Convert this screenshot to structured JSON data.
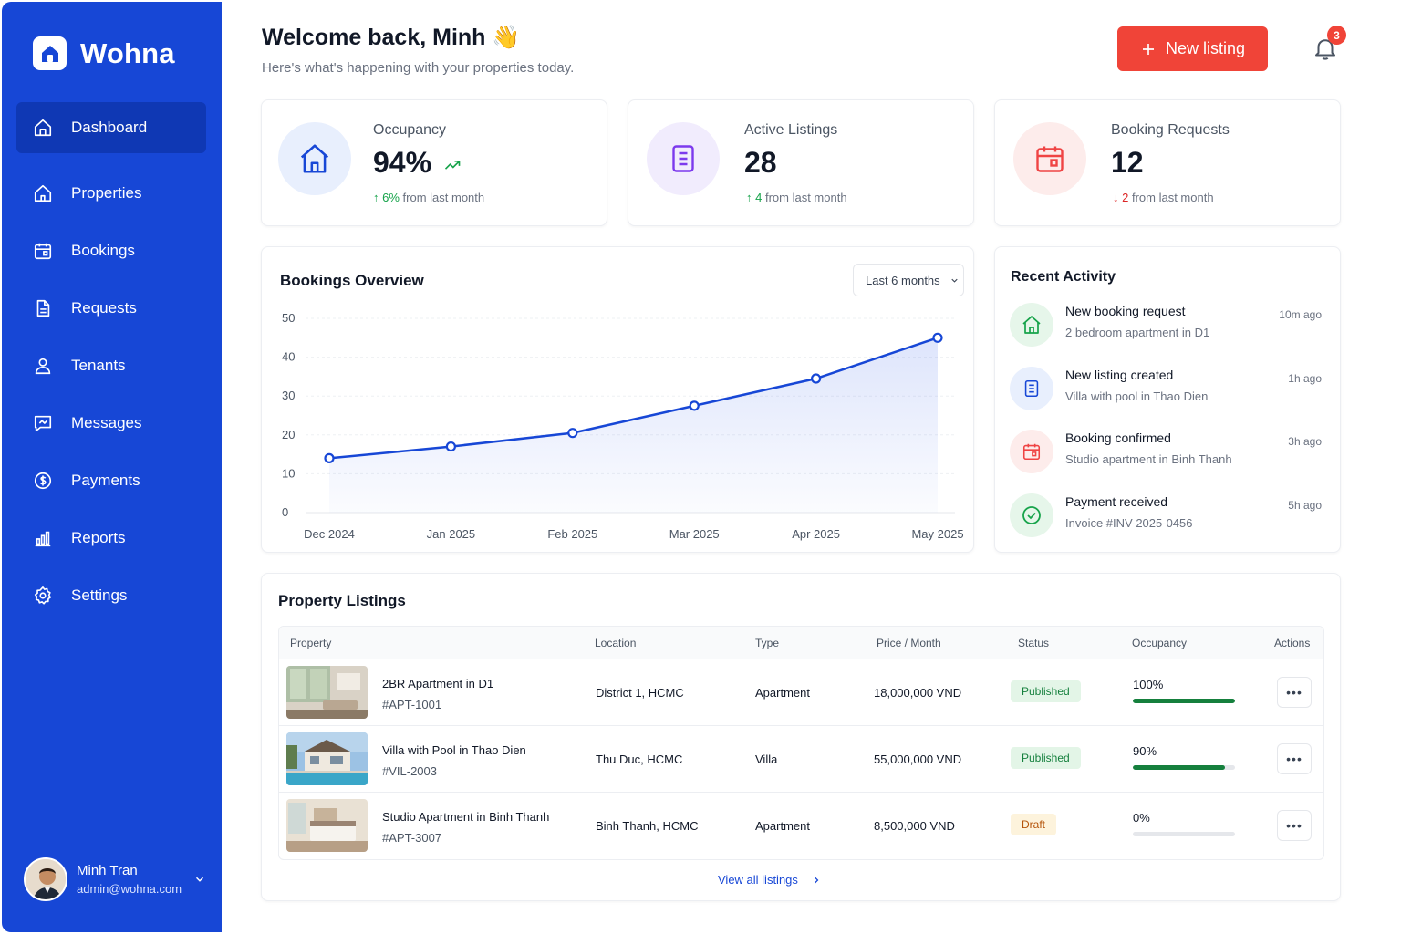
{
  "brand": {
    "name": "Wohna"
  },
  "colors": {
    "sidebar": "#1747d6",
    "accent": "#f04438",
    "primary": "#1747d6",
    "success": "#16a34a",
    "danger": "#dc2626"
  },
  "sidebar": {
    "items": [
      {
        "label": "Dashboard",
        "icon": "home-icon",
        "active": true
      },
      {
        "label": "Properties",
        "icon": "building-icon"
      },
      {
        "label": "Bookings",
        "icon": "calendar-icon"
      },
      {
        "label": "Requests",
        "icon": "document-icon"
      },
      {
        "label": "Tenants",
        "icon": "user-icon"
      },
      {
        "label": "Messages",
        "icon": "message-icon"
      },
      {
        "label": "Payments",
        "icon": "dollar-icon"
      },
      {
        "label": "Reports",
        "icon": "bar-chart-icon"
      },
      {
        "label": "Settings",
        "icon": "gear-icon"
      }
    ],
    "user": {
      "name": "Minh Tran",
      "email": "admin@wohna.com"
    }
  },
  "header": {
    "title": "Welcome back, Minh 👋",
    "subtitle": "Here's what's happening with your properties today.",
    "new_listing_label": "New listing",
    "notification_count": "3"
  },
  "stats": [
    {
      "label": "Occupancy",
      "value": "94%",
      "delta_value": "6%",
      "delta_text": " from last month",
      "trend": "up",
      "icon": "home-icon"
    },
    {
      "label": "Active Listings",
      "value": "28",
      "delta_value": "4",
      "delta_text": " from last month",
      "trend": "up",
      "icon": "document-icon"
    },
    {
      "label": "Booking Requests",
      "value": "12",
      "delta_value": "2",
      "delta_text": " from last month",
      "trend": "down",
      "icon": "calendar-icon"
    }
  ],
  "bookings_overview": {
    "title": "Bookings Overview",
    "range_label": "Last 6 months"
  },
  "chart_data": {
    "type": "area",
    "title": "Bookings Overview",
    "categories": [
      "Dec 2024",
      "Jan 2025",
      "Feb 2025",
      "Mar 2025",
      "Apr 2025",
      "May 2025"
    ],
    "values": [
      14,
      17,
      20.5,
      27.5,
      34.5,
      45
    ],
    "ylim": [
      0,
      50
    ],
    "yticks": [
      "0",
      "10",
      "20",
      "30",
      "40",
      "50"
    ],
    "grid": true
  },
  "activity": {
    "title": "Recent Activity",
    "items": [
      {
        "title": "New booking request",
        "subtitle": "2 bedroom apartment in D1",
        "time": "10m ago",
        "icon": "home-icon"
      },
      {
        "title": "New listing created",
        "subtitle": "Villa with pool in Thao Dien",
        "time": "1h ago",
        "icon": "document-icon"
      },
      {
        "title": "Booking confirmed",
        "subtitle": "Studio apartment in Binh Thanh",
        "time": "3h ago",
        "icon": "calendar-icon"
      },
      {
        "title": "Payment received",
        "subtitle": "Invoice #INV-2025-0456",
        "time": "5h ago",
        "icon": "check-circle-icon"
      }
    ]
  },
  "listings": {
    "title": "Property Listings",
    "columns": [
      "Property",
      "Location",
      "Type",
      "Price / Month",
      "Status",
      "Occupancy",
      "Actions"
    ],
    "rows": [
      {
        "name": "2BR Apartment in D1",
        "id": "#APT-1001",
        "location": "District 1, HCMC",
        "type": "Apartment",
        "price": "18,000,000 VND",
        "status": "Published",
        "occupancy": "100%",
        "occupancy_fraction": 1.0
      },
      {
        "name": "Villa with Pool in Thao Dien",
        "id": "#VIL-2003",
        "location": "Thu Duc, HCMC",
        "type": "Villa",
        "price": "55,000,000 VND",
        "status": "Published",
        "occupancy": "90%",
        "occupancy_fraction": 0.9
      },
      {
        "name": "Studio Apartment in Binh Thanh",
        "id": "#APT-3007",
        "location": "Binh Thanh, HCMC",
        "type": "Apartment",
        "price": "8,500,000 VND",
        "status": "Draft",
        "occupancy": "0%",
        "occupancy_fraction": 0.0
      }
    ],
    "view_all_label": "View all listings",
    "actions_glyph": "•••"
  }
}
